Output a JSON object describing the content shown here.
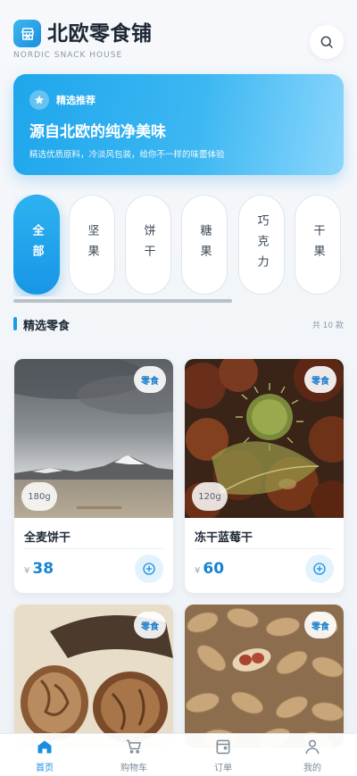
{
  "header": {
    "title": "北欧零食铺",
    "subtitle": "NORDIC SNACK HOUSE",
    "search_icon": "search-icon",
    "logo_icon": "store-icon"
  },
  "banner": {
    "tag": "精选推荐",
    "title": "源自北欧的纯净美味",
    "desc": "精选优质原料，冷淡风包装，给你不一样的味蕾体验"
  },
  "categories": [
    {
      "label": "全部",
      "active": true
    },
    {
      "label": "坚果",
      "active": false
    },
    {
      "label": "饼干",
      "active": false
    },
    {
      "label": "糖果",
      "active": false
    },
    {
      "label": "巧克力",
      "active": false
    },
    {
      "label": "干果",
      "active": false
    }
  ],
  "section": {
    "title": "精选零食",
    "count": "共 10 款"
  },
  "products": [
    {
      "name": "全麦饼干",
      "tag": "零食",
      "weight": "180g",
      "currency": "¥",
      "price": "38"
    },
    {
      "name": "冻干蓝莓干",
      "tag": "零食",
      "weight": "120g",
      "currency": "¥",
      "price": "60"
    },
    {
      "name": "",
      "tag": "零食",
      "weight": "",
      "currency": "",
      "price": ""
    },
    {
      "name": "",
      "tag": "零食",
      "weight": "",
      "currency": "",
      "price": ""
    }
  ],
  "nav": [
    {
      "label": "首页",
      "icon": "home-icon",
      "active": true
    },
    {
      "label": "购物车",
      "icon": "cart-icon",
      "active": false
    },
    {
      "label": "订单",
      "icon": "orders-icon",
      "active": false
    },
    {
      "label": "我的",
      "icon": "profile-icon",
      "active": false
    }
  ],
  "colors": {
    "accent": "#1a9ae8",
    "price": "#1683d0"
  }
}
